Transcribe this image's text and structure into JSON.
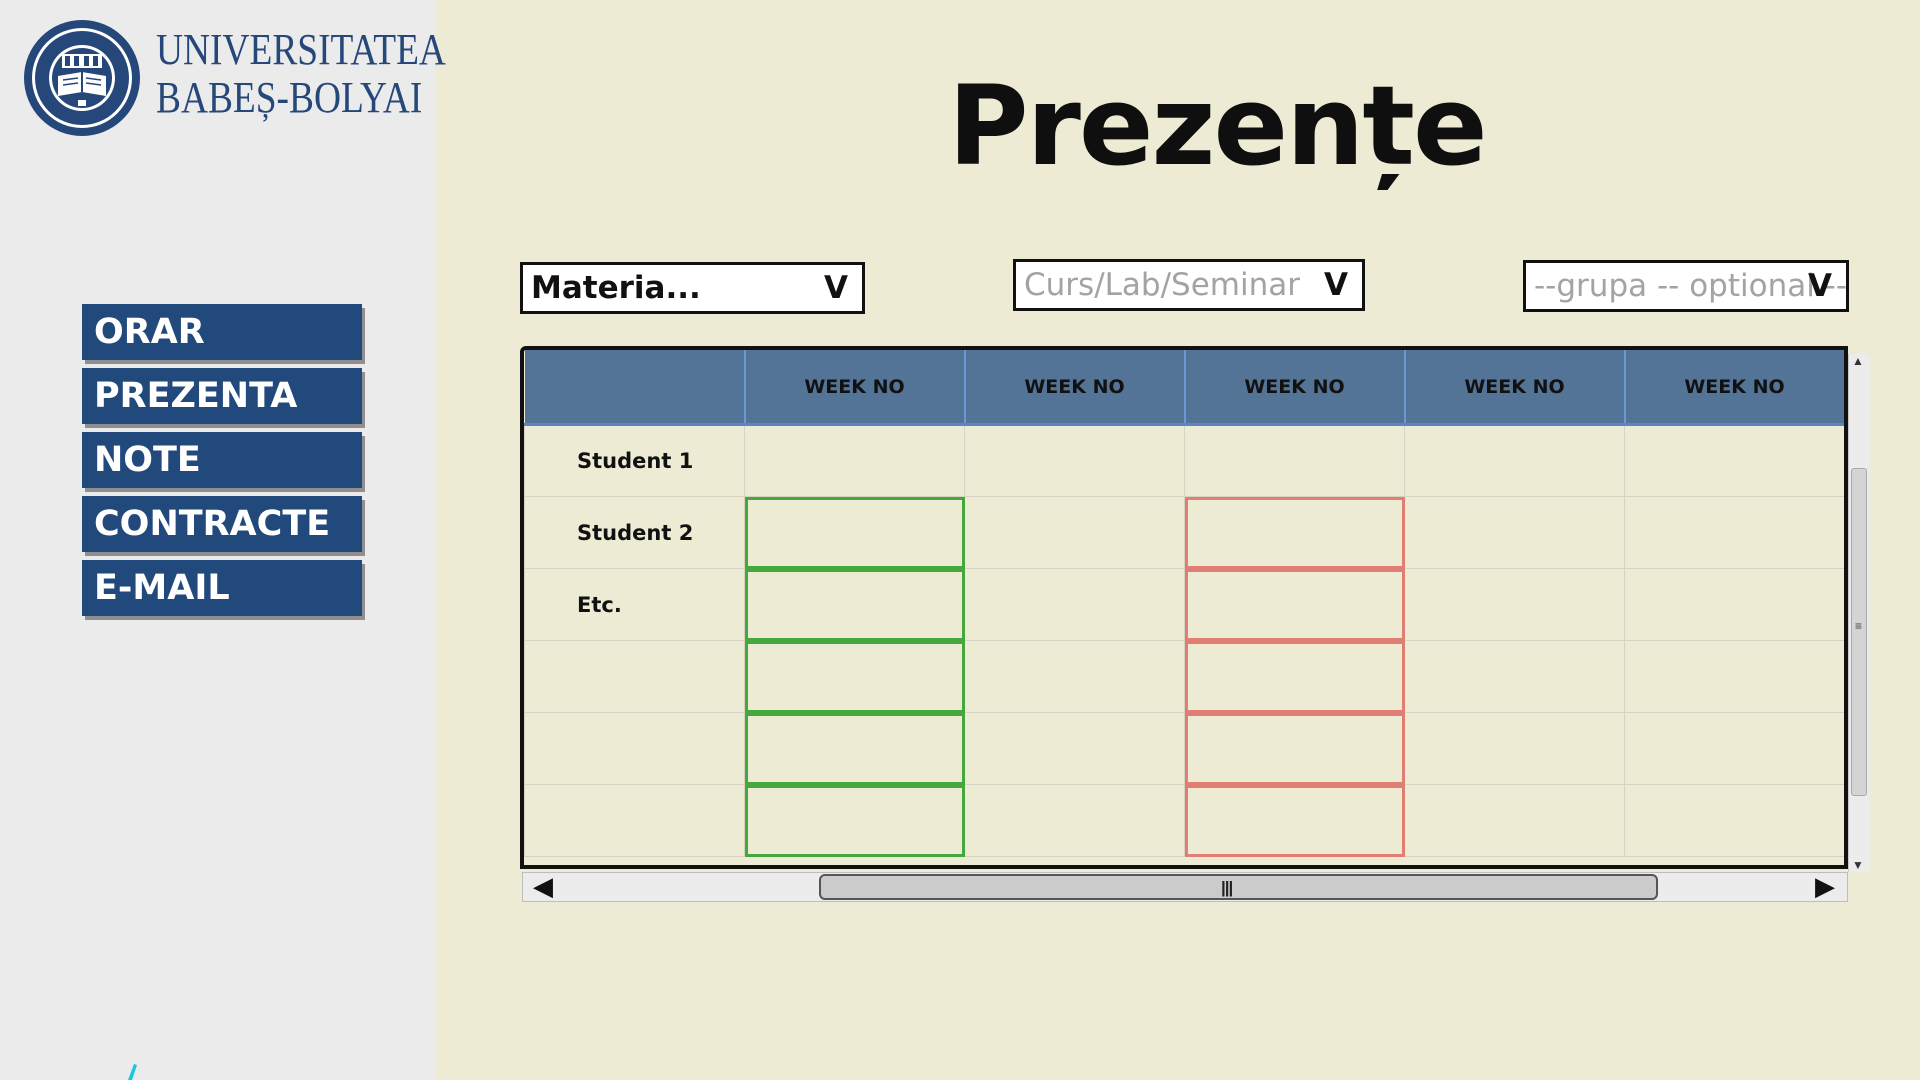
{
  "brand": {
    "name_line1": "UNIVERSITATEA",
    "name_line2": "BABEȘ-BOLYAI",
    "seal_icon": "university-seal-icon",
    "color": "#25477a"
  },
  "page_title": "Prezențe",
  "nav": {
    "items": [
      {
        "label": "ORAR"
      },
      {
        "label": "PREZENTA"
      },
      {
        "label": "NOTE"
      },
      {
        "label": "CONTRACTE"
      },
      {
        "label": "E-MAIL"
      }
    ],
    "color": "#22497c"
  },
  "filters": {
    "subject": {
      "value": "Materia...",
      "arrow": "V"
    },
    "type": {
      "placeholder": "Curs/Lab/Seminar",
      "arrow": "V"
    },
    "group": {
      "placeholder": "--grupa -- optional --",
      "arrow": "V"
    }
  },
  "table": {
    "headers": [
      "",
      "WEEK NO",
      "WEEK NO",
      "WEEK NO",
      "WEEK NO",
      "WEEK NO"
    ],
    "rows": [
      {
        "name": "Student 1",
        "marks": [
          "",
          "",
          "",
          "",
          ""
        ]
      },
      {
        "name": "Student 2",
        "marks": [
          "present",
          "",
          "absent",
          "",
          ""
        ]
      },
      {
        "name": "Etc.",
        "marks": [
          "present",
          "",
          "absent",
          "",
          ""
        ]
      },
      {
        "name": "",
        "marks": [
          "present",
          "",
          "absent",
          "",
          ""
        ]
      },
      {
        "name": "",
        "marks": [
          "present",
          "",
          "absent",
          "",
          ""
        ]
      },
      {
        "name": "",
        "marks": [
          "present",
          "",
          "absent",
          "",
          ""
        ]
      }
    ],
    "present_color": "#45a83c",
    "absent_color": "#e07e74",
    "header_color": "#547497"
  },
  "scrollbars": {
    "up_icon": "scroll-up-arrow-icon",
    "down_icon": "scroll-down-arrow-icon",
    "left_icon": "scroll-left-arrow-icon",
    "right_icon": "scroll-right-arrow-icon"
  }
}
